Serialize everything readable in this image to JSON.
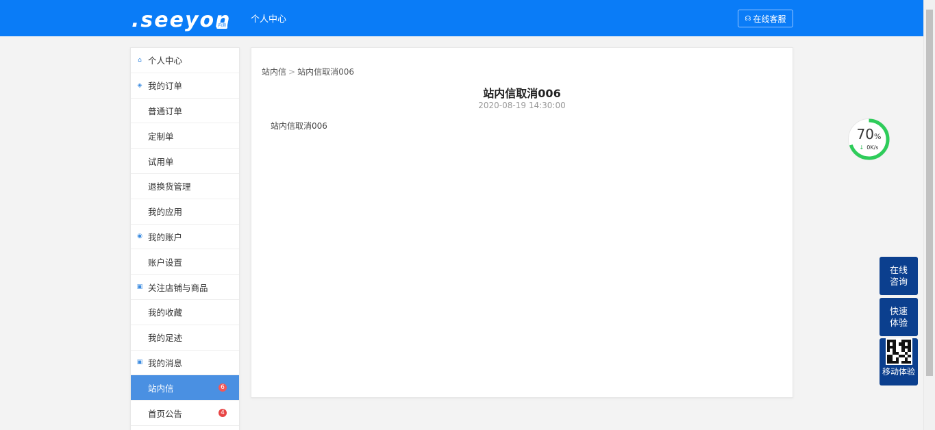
{
  "header": {
    "logo_text": ".seeyon",
    "logo_tag": "内测",
    "title": "个人中心",
    "service_button": "在线客服"
  },
  "sidebar": {
    "items": [
      {
        "label": "个人中心",
        "type": "group",
        "icon": "home-icon"
      },
      {
        "label": "我的订单",
        "type": "group",
        "icon": "layers-icon"
      },
      {
        "label": "普通订单",
        "type": "child"
      },
      {
        "label": "定制单",
        "type": "child"
      },
      {
        "label": "试用单",
        "type": "child"
      },
      {
        "label": "退换货管理",
        "type": "child"
      },
      {
        "label": "我的应用",
        "type": "child"
      },
      {
        "label": "我的账户",
        "type": "group",
        "icon": "account-icon"
      },
      {
        "label": "账户设置",
        "type": "child"
      },
      {
        "label": "关注店铺与商品",
        "type": "group",
        "icon": "store-icon"
      },
      {
        "label": "我的收藏",
        "type": "child"
      },
      {
        "label": "我的足迹",
        "type": "child"
      },
      {
        "label": "我的消息",
        "type": "group",
        "icon": "message-icon"
      },
      {
        "label": "站内信",
        "type": "child",
        "active": true,
        "badge": "6"
      },
      {
        "label": "首页公告",
        "type": "child",
        "badge": "4"
      }
    ]
  },
  "main": {
    "breadcrumb": [
      "站内信",
      "站内信取消006"
    ],
    "title": "站内信取消006",
    "time": "2020-08-19 14:30:00",
    "body": "站内信取消006"
  },
  "gauge": {
    "percent": "70",
    "percent_unit": "%",
    "speed": "0K/s"
  },
  "float_buttons": {
    "online_consult": [
      "在线",
      "咨询"
    ],
    "quick_try": [
      "快速",
      "体验"
    ],
    "mobile_try": "移动体验"
  },
  "colors": {
    "header_bg": "#0a7cf7",
    "active_item_bg": "#4a90e2",
    "float_btn_bg": "#0b3f8e",
    "badge": "#e84545",
    "gauge_ring": "#2ecc5a"
  }
}
